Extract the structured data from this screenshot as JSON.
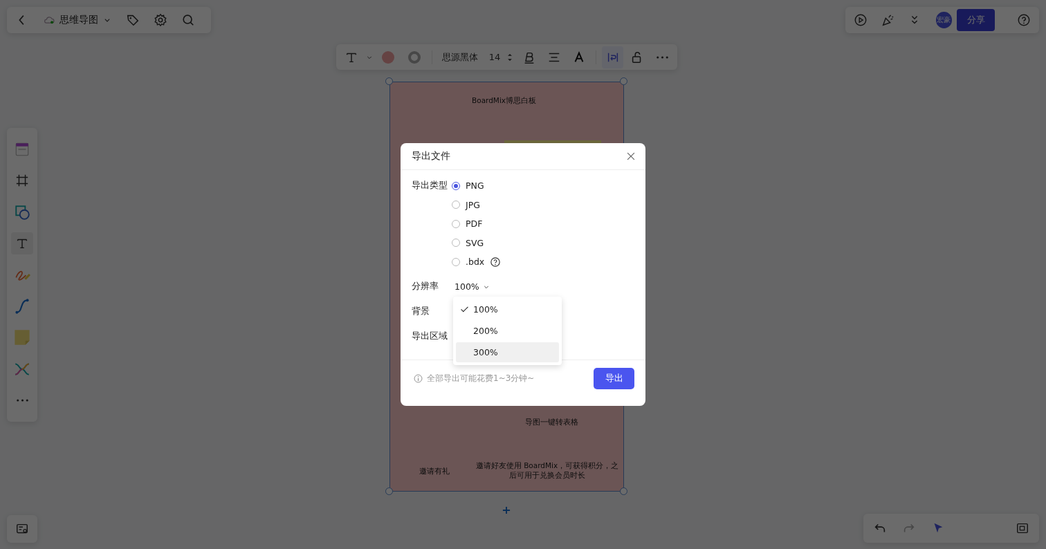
{
  "top_left_bar": {
    "doc_title": "思维导图"
  },
  "format_toolbar": {
    "font": "思源黑体",
    "font_size": "14"
  },
  "top_right_bar": {
    "avatar_text": "宏豪",
    "share_button": "分享"
  },
  "board": {
    "title": "BoardMix博思白板",
    "feature_text": "导图一键转表格",
    "invite_title": "邀请有礼",
    "invite_text": "邀请好友使用 BoardMix，可获得积分，之后可用于兑换会员时长"
  },
  "dialog": {
    "title": "导出文件",
    "type_label": "导出类型",
    "types": [
      {
        "label": "PNG",
        "selected": true,
        "help": false
      },
      {
        "label": "JPG",
        "selected": false,
        "help": false
      },
      {
        "label": "PDF",
        "selected": false,
        "help": false
      },
      {
        "label": "SVG",
        "selected": false,
        "help": false
      },
      {
        "label": ".bdx",
        "selected": false,
        "help": true
      }
    ],
    "resolution_label": "分辨率",
    "resolution_value": "100%",
    "resolution_options": [
      {
        "label": "100%",
        "selected": true,
        "hovered": false
      },
      {
        "label": "200%",
        "selected": false,
        "hovered": false
      },
      {
        "label": "300%",
        "selected": false,
        "hovered": true
      }
    ],
    "background_label": "背景",
    "area_label": "导出区域",
    "footer_note": "全部导出可能花费1~3分钟~",
    "export_button": "导出"
  }
}
